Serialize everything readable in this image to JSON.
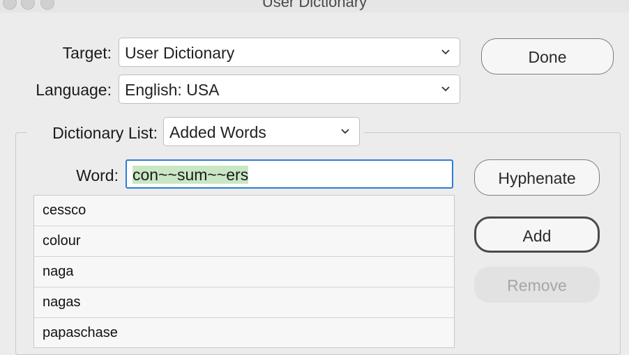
{
  "window": {
    "title": "User Dictionary"
  },
  "form": {
    "target_label": "Target:",
    "target_value": "User Dictionary",
    "language_label": "Language:",
    "language_value": "English: USA",
    "dictionary_list_label": "Dictionary List:",
    "dictionary_list_value": "Added Words",
    "word_label": "Word:",
    "word_value": "con~~sum~~ers"
  },
  "buttons": {
    "done": "Done",
    "hyphenate": "Hyphenate",
    "add": "Add",
    "remove": "Remove"
  },
  "words": [
    "cessco",
    "colour",
    "naga",
    "nagas",
    "papaschase"
  ]
}
